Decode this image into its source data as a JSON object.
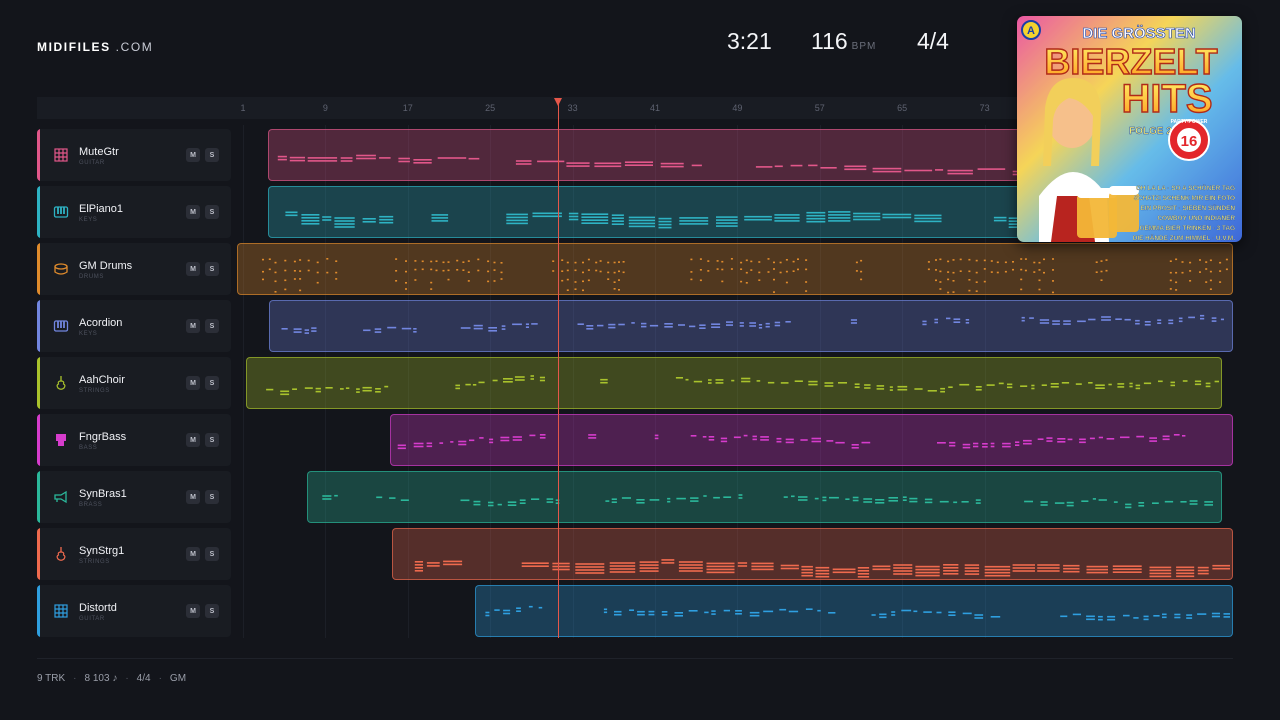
{
  "brand": {
    "bold": "MIDIFILES",
    "light": ".COM"
  },
  "header": {
    "duration": "3:21",
    "bpm": "116",
    "bpm_unit": "BPM",
    "time_signature": "4/4"
  },
  "ruler": {
    "ticks": [
      "1",
      "9",
      "17",
      "25",
      "33",
      "41",
      "49",
      "57",
      "65",
      "73"
    ]
  },
  "playhead": {
    "bar": 31
  },
  "tracks": [
    {
      "name": "MuteGtr",
      "category": "GUITAR",
      "color": "#e2578a",
      "icon": "guitar-grid-icon",
      "mute": "M",
      "solo": "S"
    },
    {
      "name": "ElPiano1",
      "category": "KEYS",
      "color": "#2eb3c4",
      "icon": "keys-icon",
      "mute": "M",
      "solo": "S"
    },
    {
      "name": "GM Drums",
      "category": "DRUMS",
      "color": "#e08b2c",
      "icon": "drum-icon",
      "mute": "M",
      "solo": "S"
    },
    {
      "name": "Acordion",
      "category": "KEYS",
      "color": "#7286e0",
      "icon": "keys-icon",
      "mute": "M",
      "solo": "S"
    },
    {
      "name": "AahChoir",
      "category": "STRINGS",
      "color": "#a9c22c",
      "icon": "violin-icon",
      "mute": "M",
      "solo": "S"
    },
    {
      "name": "FngrBass",
      "category": "BASS",
      "color": "#d63ccc",
      "icon": "bass-icon",
      "mute": "M",
      "solo": "S"
    },
    {
      "name": "SynBras1",
      "category": "BRASS",
      "color": "#2bb89b",
      "icon": "trumpet-icon",
      "mute": "M",
      "solo": "S"
    },
    {
      "name": "SynStrg1",
      "category": "STRINGS",
      "color": "#ef6a4e",
      "icon": "violin-icon",
      "mute": "M",
      "solo": "S"
    },
    {
      "name": "Distortd",
      "category": "GUITAR",
      "color": "#2f9fe0",
      "icon": "guitar-grid-icon",
      "mute": "M",
      "solo": "S"
    }
  ],
  "cover": {
    "badge": "A",
    "title_line1": "DIE GRÖSSTEN",
    "title_line2": "BIERZELT",
    "title_line3": "HITS",
    "folge": "FOLGE 2",
    "count": "16",
    "seal_text": "PARTY-POWER",
    "songs": [
      "OH LA LA · SO A SCHÖNER TAG",
      "SCHATZI SCHENK MIR EIN FOTO",
      "EIN PROSIT · SIEBEN SÜNDEN",
      "COWBOY UND INDIANER",
      "GEMMA BIER TRINKEN · 3 TAG",
      "DIE HÄNDE ZUM HIMMEL · U.V.M."
    ]
  },
  "footer": {
    "tracks": "9 TRK",
    "notes": "8 103 ♪",
    "time_signature": "4/4",
    "standard": "GM"
  }
}
